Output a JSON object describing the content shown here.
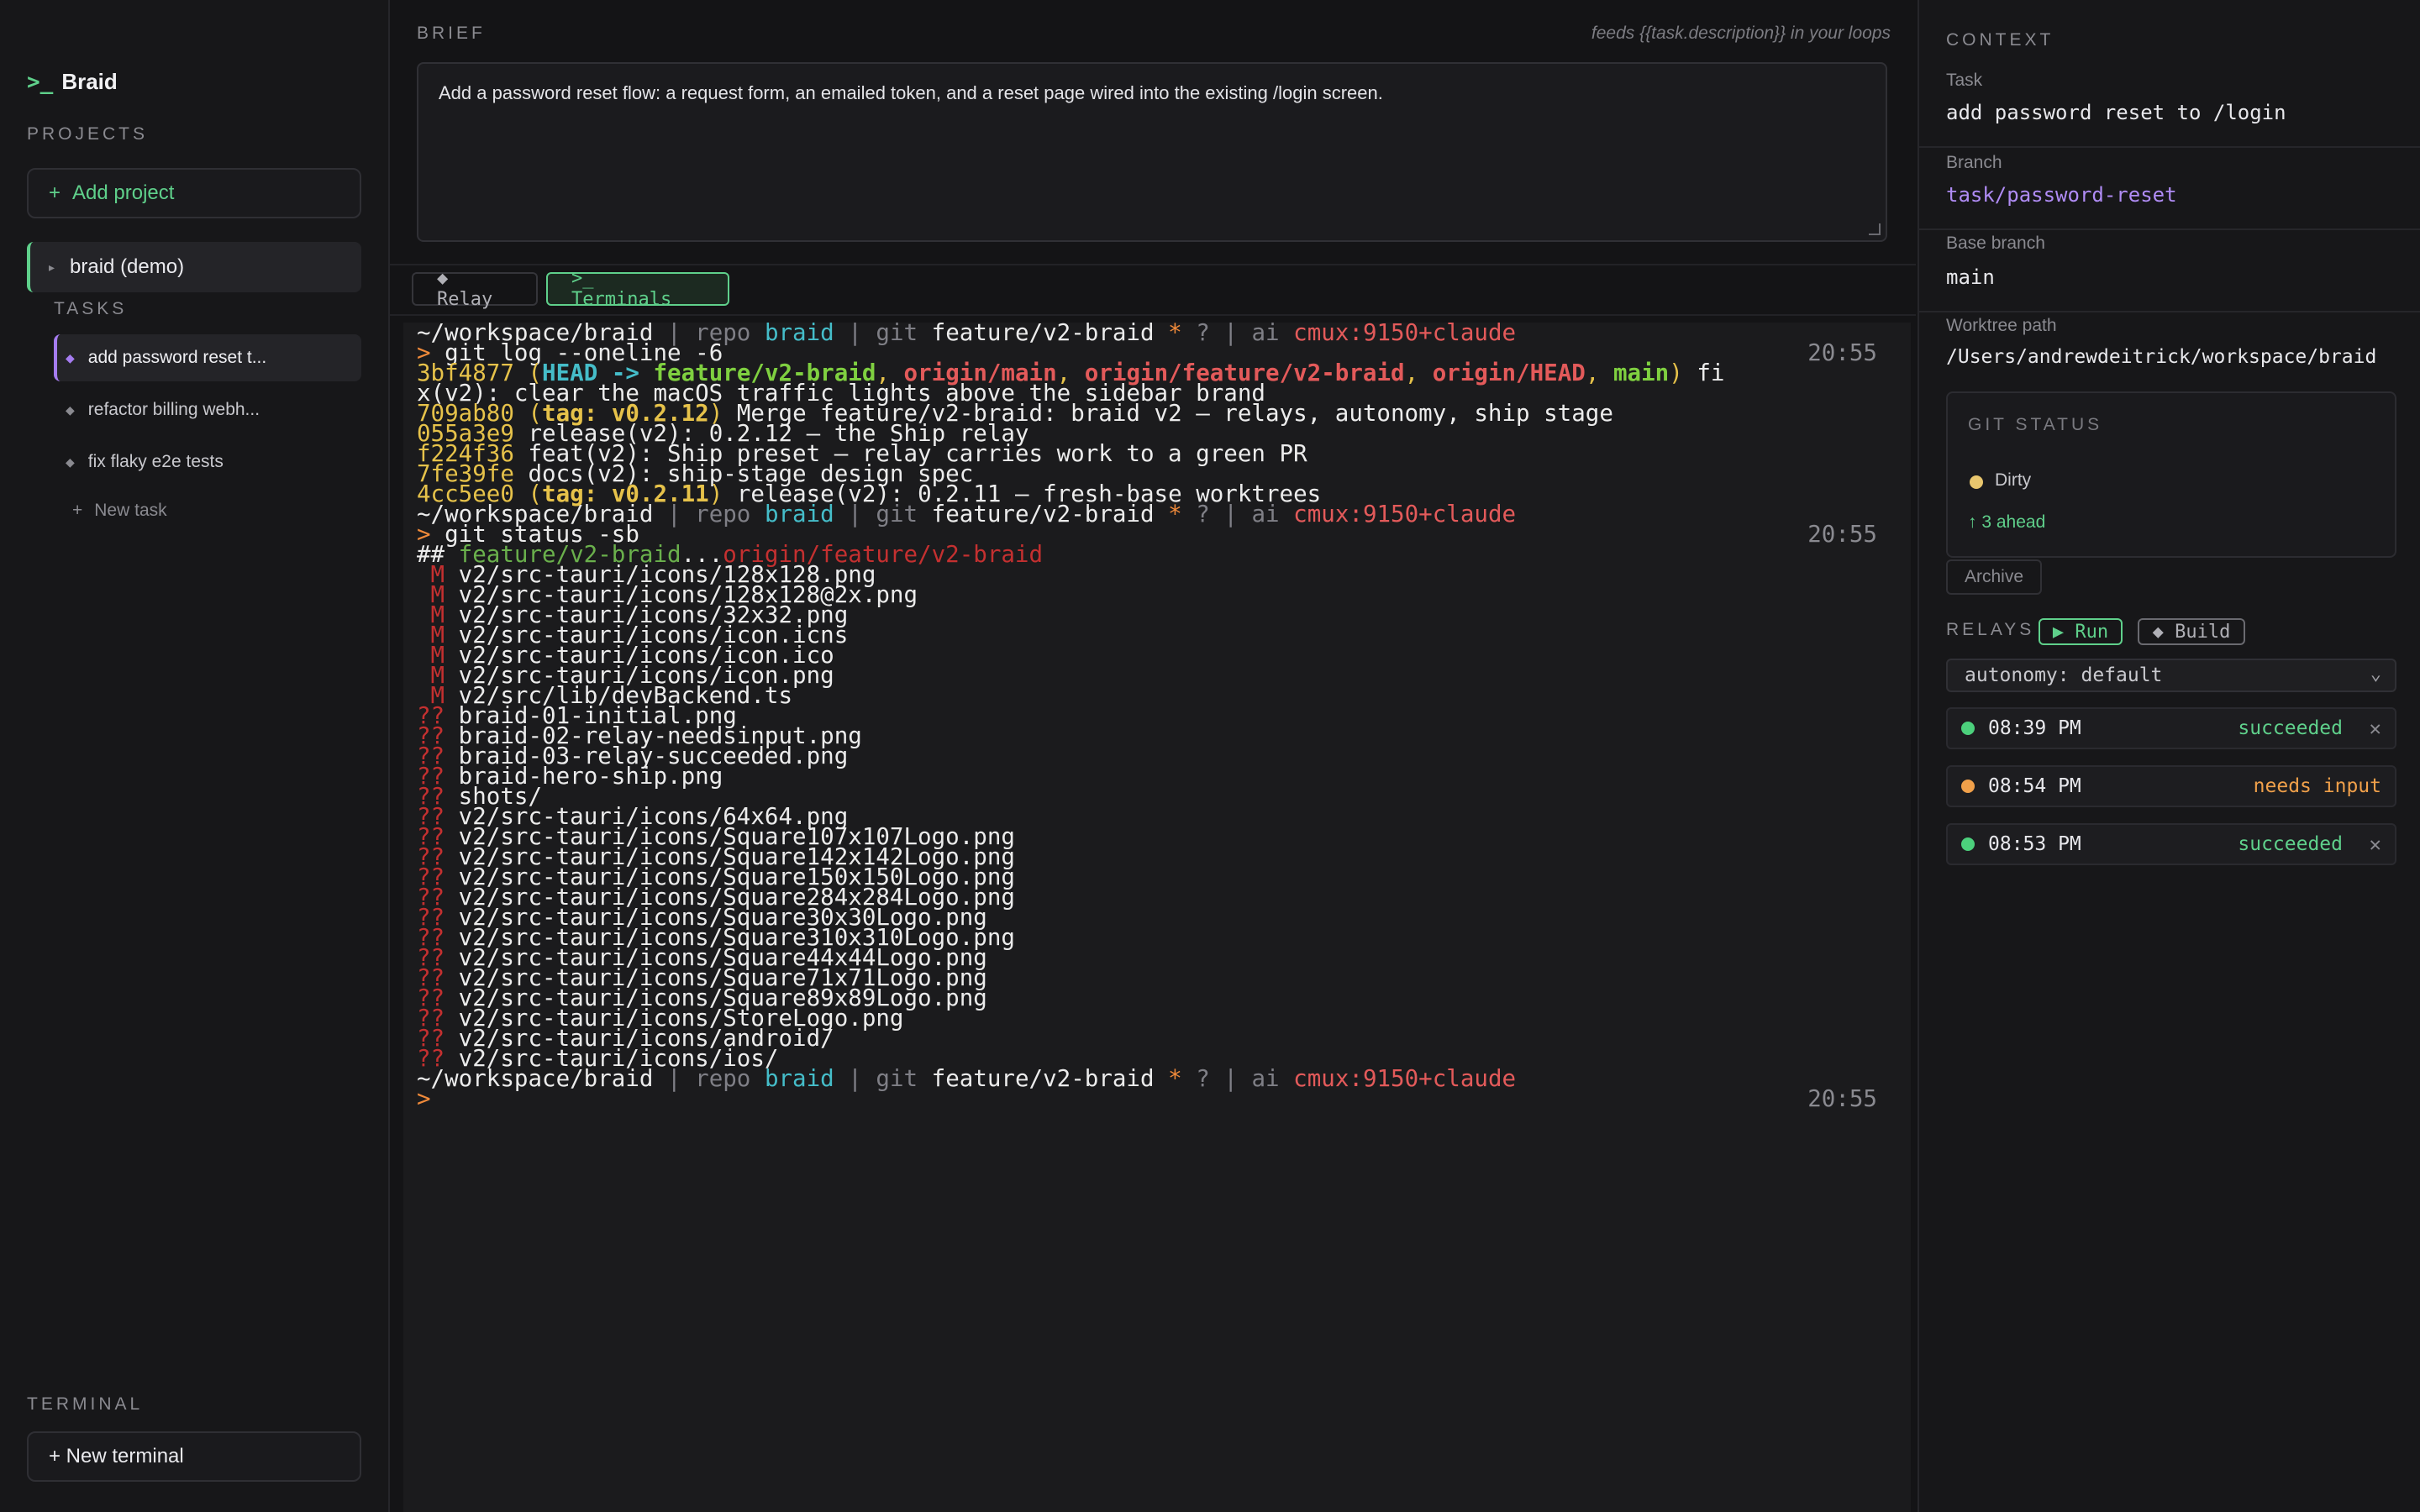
{
  "sidebar": {
    "brand_prompt": ">_",
    "brand": "Braid",
    "projects_label": "PROJECTS",
    "add_project": "Add project",
    "project_name": "braid (demo)",
    "tasks_label": "TASKS",
    "tasks": [
      {
        "label": "add password reset t..."
      },
      {
        "label": "refactor billing webh..."
      },
      {
        "label": "fix flaky e2e tests"
      }
    ],
    "new_task": "New task",
    "terminal_label": "TERMINAL",
    "new_terminal": "+ New terminal"
  },
  "brief": {
    "label": "BRIEF",
    "hint": "feeds {{task.description}} in your loops",
    "text": "Add a password reset flow: a request form, an emailed token, and a reset page wired into the existing /login screen."
  },
  "tabs": {
    "relay": "◆ Relay",
    "terminals": ">_ Terminals"
  },
  "terminal": {
    "prompt": {
      "dir": "~/workspace/braid",
      "repo_key": "repo",
      "repo": "braid",
      "git_key": "git",
      "branch": "feature/v2-braid",
      "dirty": "*",
      "q": "?",
      "ai_key": "ai",
      "ai": "cmux:9150+claude",
      "time": "20:55"
    },
    "cmd1": "git log --oneline -6",
    "log": [
      {
        "hash": "3bf4877",
        "refs": true,
        "msg": " fi"
      },
      {
        "hash": "709ab80",
        "tag": "tag: v0.2.12",
        "msg": " Merge feature/v2-braid: braid v2 — relays, autonomy, ship stage"
      },
      {
        "hash": "055a3e9",
        "msg": " release(v2): 0.2.12 — the Ship relay"
      },
      {
        "hash": "f224f36",
        "msg": " feat(v2): Ship preset — relay carries work to a green PR"
      },
      {
        "hash": "7fe39fe",
        "msg": " docs(v2): ship-stage design spec"
      },
      {
        "hash": "4cc5ee0",
        "tag": "tag: v0.2.11",
        "msg": " release(v2): 0.2.11 — fresh-base worktrees"
      }
    ],
    "log_wrap": "x(v2): clear the macOS traffic lights above the sidebar brand",
    "refs": {
      "head": "HEAD",
      "arrow": " -> ",
      "local": "feature/v2-braid",
      "r1": "origin/main",
      "r2": "origin/feature/v2-braid",
      "r3": "origin/HEAD",
      "main": "main"
    },
    "cmd2": "git status -sb",
    "status_head_hash": "## ",
    "status_local": "feature/v2-braid",
    "status_dots": "...",
    "status_remote": "origin/feature/v2-braid",
    "modified": [
      "v2/src-tauri/icons/128x128.png",
      "v2/src-tauri/icons/128x128@2x.png",
      "v2/src-tauri/icons/32x32.png",
      "v2/src-tauri/icons/icon.icns",
      "v2/src-tauri/icons/icon.ico",
      "v2/src-tauri/icons/icon.png",
      "v2/src/lib/devBackend.ts"
    ],
    "untracked": [
      "braid-01-initial.png",
      "braid-02-relay-needsinput.png",
      "braid-03-relay-succeeded.png",
      "braid-hero-ship.png",
      "shots/",
      "v2/src-tauri/icons/64x64.png",
      "v2/src-tauri/icons/Square107x107Logo.png",
      "v2/src-tauri/icons/Square142x142Logo.png",
      "v2/src-tauri/icons/Square150x150Logo.png",
      "v2/src-tauri/icons/Square284x284Logo.png",
      "v2/src-tauri/icons/Square30x30Logo.png",
      "v2/src-tauri/icons/Square310x310Logo.png",
      "v2/src-tauri/icons/Square44x44Logo.png",
      "v2/src-tauri/icons/Square71x71Logo.png",
      "v2/src-tauri/icons/Square89x89Logo.png",
      "v2/src-tauri/icons/StoreLogo.png",
      "v2/src-tauri/icons/android/",
      "v2/src-tauri/icons/ios/"
    ]
  },
  "context": {
    "label": "CONTEXT",
    "task_label": "Task",
    "task": "add password reset to /login",
    "branch_label": "Branch",
    "branch": "task/password-reset",
    "base_label": "Base branch",
    "base": "main",
    "worktree_label": "Worktree path",
    "worktree": "/Users/andrewdeitrick/workspace/braid",
    "git_status_label": "GIT STATUS",
    "dirty": "Dirty",
    "ahead": "↑ 3 ahead",
    "archive": "Archive",
    "relays_label": "RELAYS",
    "run": "▶ Run",
    "build": "◆ Build",
    "autonomy": "autonomy: default",
    "relays": [
      {
        "time": "08:39 PM",
        "status": "succeeded"
      },
      {
        "time": "08:54 PM",
        "status": "needs input"
      },
      {
        "time": "08:53 PM",
        "status": "succeeded"
      }
    ]
  },
  "colors": {
    "accent_green": "#5fd08b",
    "accent_purple": "#a57cf0",
    "warn_orange": "#f0a04a",
    "dirty_yellow": "#e8c66e"
  }
}
